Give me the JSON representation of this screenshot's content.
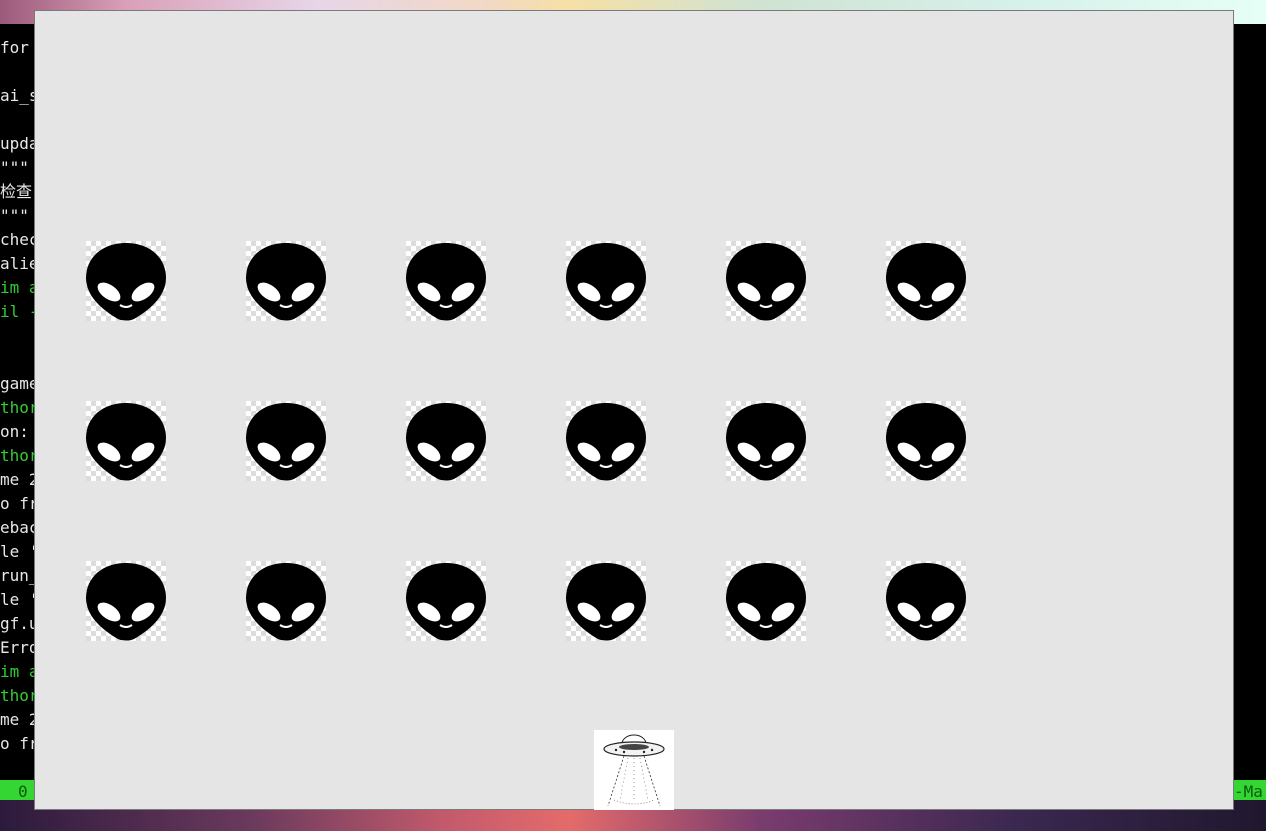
{
  "terminal": {
    "lines": [
      {
        "text": "for",
        "color": "white"
      },
      {
        "text": "",
        "color": "white"
      },
      {
        "text": "ai_s",
        "color": "white"
      },
      {
        "text": "",
        "color": "white"
      },
      {
        "text": "upda",
        "color": "white"
      },
      {
        "text": "\"\"\"",
        "color": "white"
      },
      {
        "text": "检查",
        "color": "white"
      },
      {
        "text": "\"\"\"",
        "color": "white"
      },
      {
        "text": "chec",
        "color": "white"
      },
      {
        "text": "alie",
        "color": "white"
      },
      {
        "text": "im a",
        "color": "green"
      },
      {
        "text": "il -",
        "color": "green"
      },
      {
        "text": "",
        "color": "white"
      },
      {
        "text": "",
        "color": "white"
      },
      {
        "text": "game",
        "color": "white"
      },
      {
        "text": "thor",
        "color": "green"
      },
      {
        "text": "on:",
        "color": "white"
      },
      {
        "text": "thor",
        "color": "green"
      },
      {
        "text": "me 2",
        "color": "white"
      },
      {
        "text": "o fr",
        "color": "white"
      },
      {
        "text": "ebac",
        "color": "white"
      },
      {
        "text": "le '",
        "color": "white"
      },
      {
        "text": "run_",
        "color": "white"
      },
      {
        "text": "le '",
        "color": "white"
      },
      {
        "text": "gf.u",
        "color": "white"
      },
      {
        "text": "Erro",
        "color": "white"
      },
      {
        "text": "im a",
        "color": "green"
      },
      {
        "text": "thor",
        "color": "green"
      },
      {
        "text": "me 2",
        "color": "white"
      },
      {
        "text": "o fr",
        "color": "white"
      }
    ],
    "status_left": "0",
    "status_right": "-Ma"
  },
  "game": {
    "alien_icon": "alien-head-icon",
    "ship_icon": "ufo-ship-icon",
    "alien_rows": 3,
    "alien_cols": 6
  },
  "colors": {
    "game_bg": "#e5e5e5",
    "alien": "#000000",
    "terminal_green": "#33cc33"
  }
}
